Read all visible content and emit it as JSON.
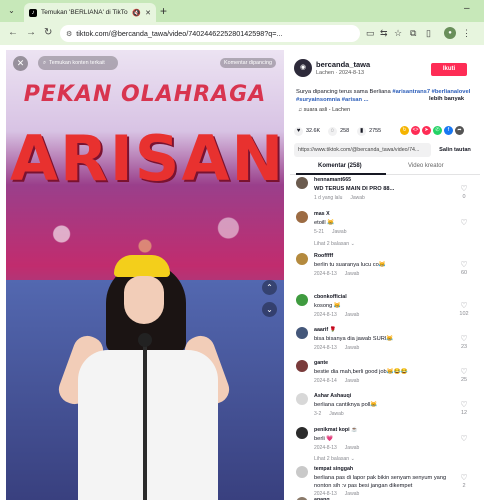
{
  "browser": {
    "tab_title": "Temukan 'BERLIANA' di TikTok",
    "url": "tiktok.com/@bercanda_tawa/video/7402446225280142598?q=..."
  },
  "video": {
    "banner_top": "PEKAN OLAHRAGA",
    "banner_big": "ARISAN",
    "search_placeholder": "Temukan konten terkait",
    "report_label": "Komentar dipancing"
  },
  "author": {
    "name": "bercanda_tawa",
    "meta": "Lachen · 2024-8-13",
    "follow_label": "Ikuti",
    "description": "Surya dipancing terus sama Berliana ",
    "hashtags": "#arisantrans7 #berlianalovel #suryainsomnia #arisan ...",
    "more_label": "lebih banyak",
    "sound": "suara asli - Lachen"
  },
  "stats": {
    "likes": "32.6K",
    "comments": "258",
    "saves": "2755"
  },
  "share": {
    "link": "https://www.tiktok.com/@bercanda_tawa/video/74...",
    "copy_label": "Salin tautan"
  },
  "tabs": {
    "comments": "Komentar (258)",
    "creator": "Video kreator"
  },
  "comments": [
    {
      "user": "hennamant665",
      "text": "WD TERUS MAIN DI PRO 88...",
      "date": "1 d yang lalu",
      "reply": "Jawab",
      "likes": "0",
      "bold": true,
      "avatar_color": "#6b5b4e",
      "replies": ""
    },
    {
      "user": "mas X",
      "text": "etoill 😹",
      "date": "5-21",
      "reply": "Jawab",
      "likes": "",
      "bold": false,
      "avatar_color": "#9c6b43",
      "replies": "Lihat 2 balasan ⌄"
    },
    {
      "user": "Roofffff",
      "text": "berlin tu suaranya lucu co😹",
      "date": "2024-8-13",
      "reply": "Jawab",
      "likes": "60",
      "bold": false,
      "avatar_color": "#b48a3e",
      "replies": ""
    },
    {
      "user": "cbonkofficial",
      "text": "kosong 😹",
      "date": "2024-8-13",
      "reply": "Jawab",
      "likes": "102",
      "bold": false,
      "avatar_color": "#3f9b3f",
      "replies": ""
    },
    {
      "user": "aaarif 🌹",
      "text": "bisa bisanya dia jawab SURI😹",
      "date": "2024-8-13",
      "reply": "Jawab",
      "likes": "23",
      "bold": false,
      "avatar_color": "#44577a",
      "replies": ""
    },
    {
      "user": "gante",
      "text": "bestie dia mah,berli good job😹😂😂",
      "date": "2024-8-14",
      "reply": "Jawab",
      "likes": "25",
      "bold": false,
      "avatar_color": "#7a3b3b",
      "replies": ""
    },
    {
      "user": "Ashar Ashauqi",
      "text": "berliana cantiknya poll😹",
      "date": "3-2",
      "reply": "Jawab",
      "likes": "12",
      "bold": false,
      "avatar_color": "#d8d8d8",
      "replies": ""
    },
    {
      "user": "penikmat kopi ☕",
      "text": "berli 💗",
      "date": "2024-8-13",
      "reply": "Jawab",
      "likes": "",
      "bold": false,
      "avatar_color": "#2b2b2b",
      "replies": "Lihat 2 balasan ⌄"
    },
    {
      "user": "tempat singgah",
      "text": "berliana pas di lapor pak bikin senyam senyum yang nonton sih :v pas besi jangan dikempet",
      "date": "2024-8-13",
      "reply": "Jawab",
      "likes": "2",
      "bold": false,
      "avatar_color": "#c9c9c9",
      "replies": ""
    },
    {
      "user": "anang",
      "text": "",
      "date": "",
      "reply": "",
      "likes": "",
      "bold": false,
      "avatar_color": "#8a7a6a",
      "replies": ""
    }
  ],
  "colors": {
    "accent": "#fe2c55",
    "tab_green": "#c7e8b9",
    "link_blue": "#2b5db9"
  }
}
